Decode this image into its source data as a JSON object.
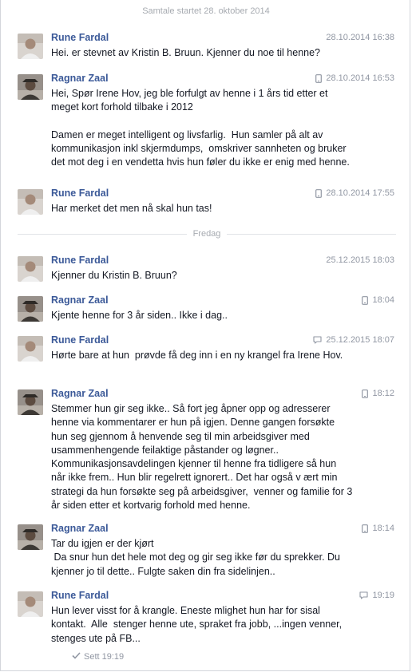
{
  "conversation": {
    "started_label": "Samtale startet 28. oktober 2014",
    "day_divider": "Fredag",
    "seen_label": "Sett 19:19"
  },
  "messages": [
    {
      "sender": "Rune Fardal",
      "avatar": "rune-avatar",
      "source_icon": "",
      "time": "28.10.2014 16:38",
      "paragraphs": [
        "Hei. er stevnet av Kristin B. Bruun. Kjenner du noe til henne?"
      ]
    },
    {
      "sender": "Ragnar Zaal",
      "avatar": "ragnar-avatar",
      "source_icon": "mobile-icon",
      "time": "28.10.2014 16:53",
      "paragraphs": [
        "Hei, Spør Irene Hov, jeg ble forfulgt av henne i 1 års tid etter et meget kort forhold tilbake i 2012",
        "Damen er meget intelligent og livsfarlig.  Hun samler på alt av kommunikasjon inkl skjermdumps,  omskriver sannheten og bruker det mot deg i en vendetta hvis hun føler du ikke er enig med henne."
      ]
    },
    {
      "sender": "Rune Fardal",
      "avatar": "rune-avatar",
      "source_icon": "mobile-icon",
      "time": "28.10.2014 17:55",
      "paragraphs": [
        "Har merket det men nå skal hun tas!"
      ]
    },
    {
      "sender": "Rune Fardal",
      "avatar": "rune-avatar",
      "source_icon": "",
      "time": "25.12.2015 18:03",
      "paragraphs": [
        "Kjenner du Kristin B. Bruun?"
      ]
    },
    {
      "sender": "Ragnar Zaal",
      "avatar": "ragnar-avatar",
      "source_icon": "mobile-icon",
      "time": "18:04",
      "paragraphs": [
        "Kjente henne for 3 år siden.. Ikke i dag.."
      ]
    },
    {
      "sender": "Rune Fardal",
      "avatar": "rune-avatar",
      "source_icon": "chat-icon",
      "time": "25.12.2015 18:07",
      "paragraphs": [
        "Hørte bare at hun  prøvde få deg inn i en ny krangel fra Irene Hov."
      ]
    },
    {
      "sender": "Ragnar Zaal",
      "avatar": "ragnar-avatar",
      "source_icon": "mobile-icon",
      "time": "18:12",
      "paragraphs": [
        "Stemmer hun gir seg ikke.. Så fort jeg åpner opp og adresserer henne via kommentarer er hun på igjen. Denne gangen forsøkte hun seg gjennom å henvende seg til min arbeidsgiver med usammenhengende feilaktige påstander og løgner.. Kommunikasjonsavdelingen kjenner til henne fra tidligere så hun når ikke frem.. Hun blir regelrett ignorert.. Det har også v ært min strategi da hun forsøkte seg på arbeidsgiver,  venner og familie for 3 år siden etter et kortvarig forhold med henne."
      ]
    },
    {
      "sender": "Ragnar Zaal",
      "avatar": "ragnar-avatar",
      "source_icon": "mobile-icon",
      "time": "18:14",
      "paragraphs": [
        "Tar du igjen er der kjørt\n Da snur hun det hele mot deg og gir seg ikke før du sprekker. Du kjenner jo til dette.. Fulgte saken din fra sidelinjen.."
      ]
    },
    {
      "sender": "Rune Fardal",
      "avatar": "rune-avatar",
      "source_icon": "chat-icon",
      "time": "19:19",
      "paragraphs": [
        "Hun lever visst for å krangle. Eneste mlighet hun har for sisal kontakt.  Alle  stenger henne ute, spraket fra jobb, ...ingen venner, stenges ute på FB..."
      ]
    }
  ]
}
